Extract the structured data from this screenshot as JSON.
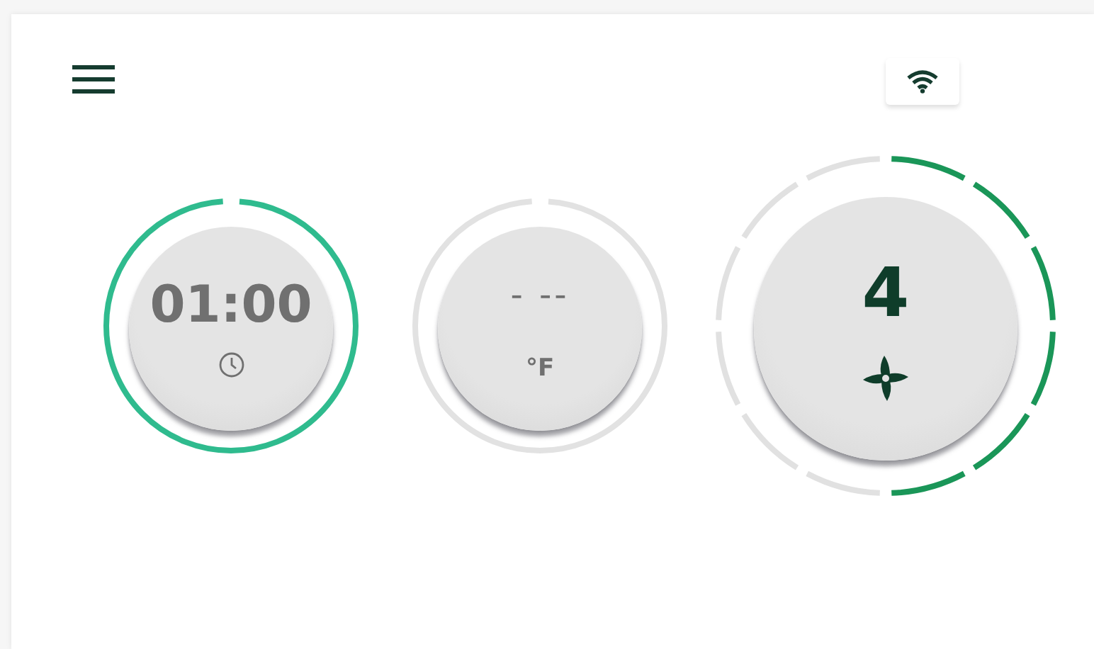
{
  "dials": [
    {
      "kind": "timer",
      "value": "01:00",
      "active": true
    },
    {
      "kind": "temperature",
      "value": "- --",
      "unit": "°F",
      "active": false
    },
    {
      "kind": "fan",
      "value": "4"
    }
  ]
}
